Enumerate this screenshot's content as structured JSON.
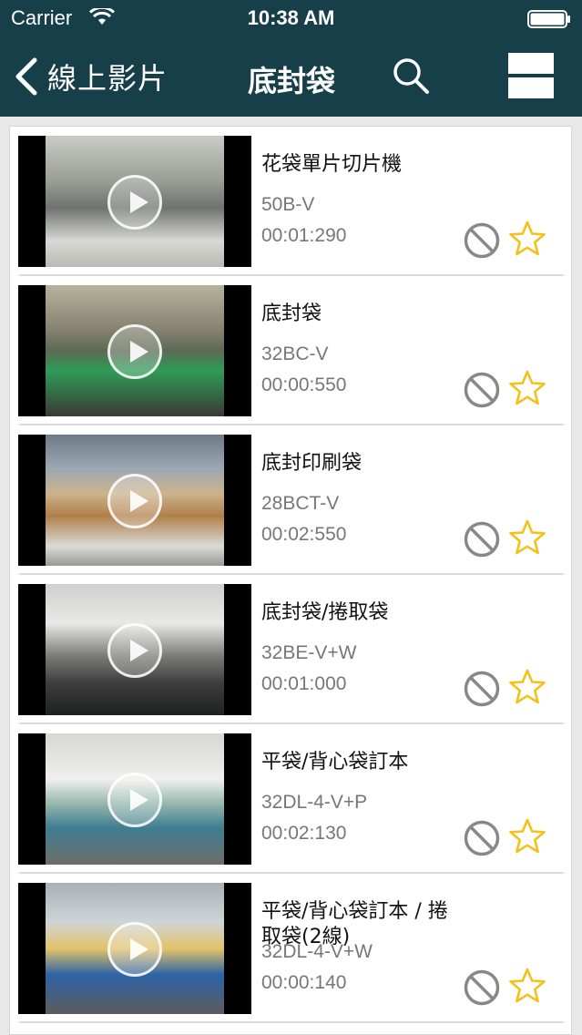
{
  "status_bar": {
    "carrier": "Carrier",
    "time": "10:38 AM",
    "wifi_icon": "wifi-icon",
    "battery_icon": "battery-icon"
  },
  "nav": {
    "back_label": "線上影片",
    "title": "底封袋",
    "search_icon": "search-icon",
    "menu_icon": "menu-icon"
  },
  "colors": {
    "nav_background": "#173f4a",
    "star": "#f2c21b",
    "block_icon": "#888888"
  },
  "videos": [
    {
      "title": "花袋單片切片機",
      "model": "50B-V",
      "duration": "00:01:290"
    },
    {
      "title": "底封袋",
      "model": "32BC-V",
      "duration": "00:00:550"
    },
    {
      "title": "底封印刷袋",
      "model": "28BCT-V",
      "duration": "00:02:550"
    },
    {
      "title": "底封袋/捲取袋",
      "model": "32BE-V+W",
      "duration": "00:01:000"
    },
    {
      "title": "平袋/背心袋訂本",
      "model": "32DL-4-V+P",
      "duration": "00:02:130"
    },
    {
      "title": "平袋/背心袋訂本 / 捲取袋(2線)",
      "model": "32DL-4-V+W",
      "duration": "00:00:140"
    }
  ]
}
